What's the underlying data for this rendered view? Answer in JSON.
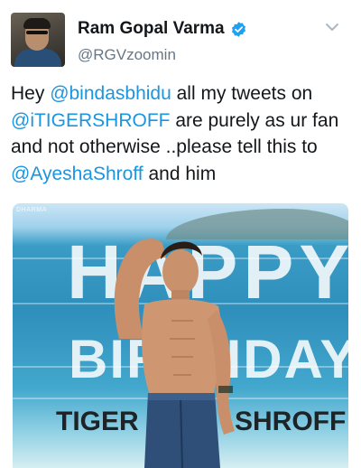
{
  "tweet": {
    "author": {
      "display_name": "Ram Gopal Varma",
      "handle": "@RGVzoomin",
      "verified": true,
      "avatar_icon": "profile-photo"
    },
    "menu_icon": "chevron-down-icon",
    "text": {
      "p1": "Hey ",
      "m1": "@bindasbhidu",
      "p2": " all my tweets on ",
      "m2": "@iTIGERSHROFF",
      "p3": " are purely as ur fan and not otherwise ..please tell this to ",
      "m3": "@AyeshaShroff",
      "p4": " and him"
    },
    "media": {
      "watermark": "DHARMA",
      "headline_1": "HAPPY",
      "headline_2": "BIRTHDAY",
      "name_1": "TIGER",
      "name_2": "SHROFF"
    },
    "colors": {
      "mention": "#1b95e0",
      "verified_badge": "#1da1f2",
      "handle": "#657786"
    }
  }
}
